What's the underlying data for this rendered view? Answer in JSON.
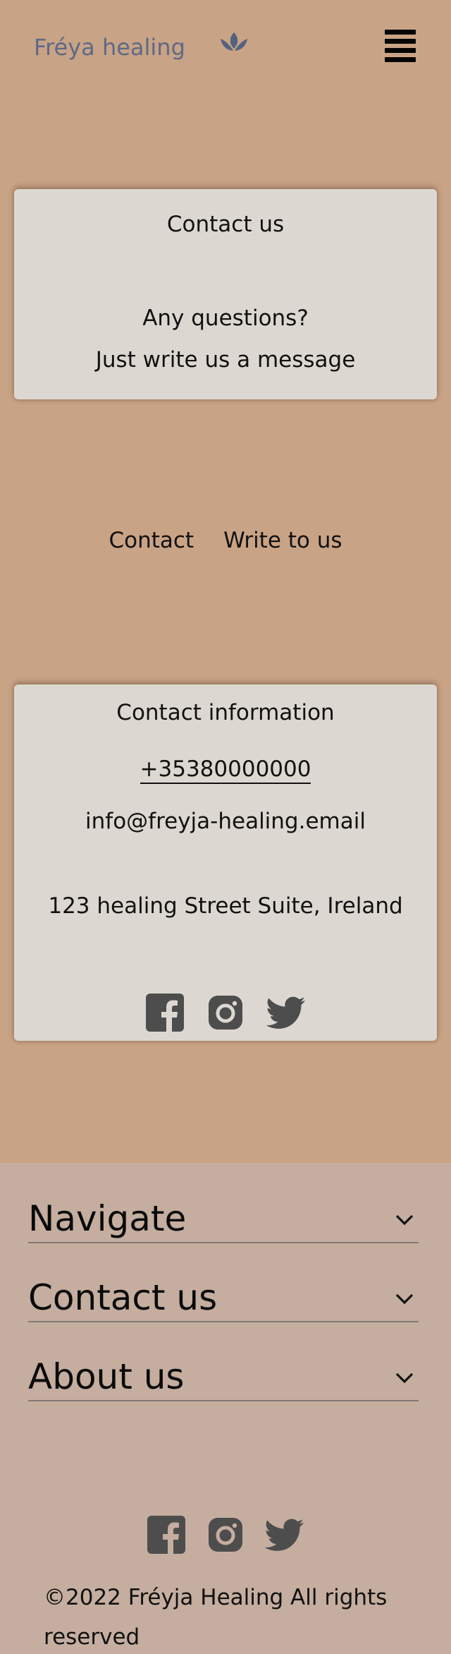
{
  "header": {
    "logo_text": "Fréya healing",
    "logo_icon": "lotus-icon",
    "menu_icon": "hamburger-menu-icon"
  },
  "hero_card": {
    "title": "Contact us",
    "line1": "Any questions?",
    "line2": "Just write us a message"
  },
  "tabs": [
    {
      "label": "Contact"
    },
    {
      "label": "Write to us"
    }
  ],
  "contact_card": {
    "title": "Contact information",
    "phone": "+35380000000",
    "email": "info@freyja-healing.email",
    "address": "123 healing Street Suite, Ireland",
    "socials": [
      "facebook-icon",
      "instagram-icon",
      "twitter-icon"
    ]
  },
  "footer": {
    "accordions": [
      {
        "label": "Navigate"
      },
      {
        "label": "Contact us"
      },
      {
        "label": "About us"
      }
    ],
    "socials": [
      "facebook-icon",
      "instagram-icon",
      "twitter-icon"
    ],
    "copyright": "©2022 Fréyja Healing All rights reserved"
  },
  "colors": {
    "page_bg": "#c9a386",
    "card_bg": "#dcd8d1",
    "footer_bg": "#c5ae9f",
    "logo_color": "#5d6a86",
    "icon_color": "#4d4d4d"
  }
}
